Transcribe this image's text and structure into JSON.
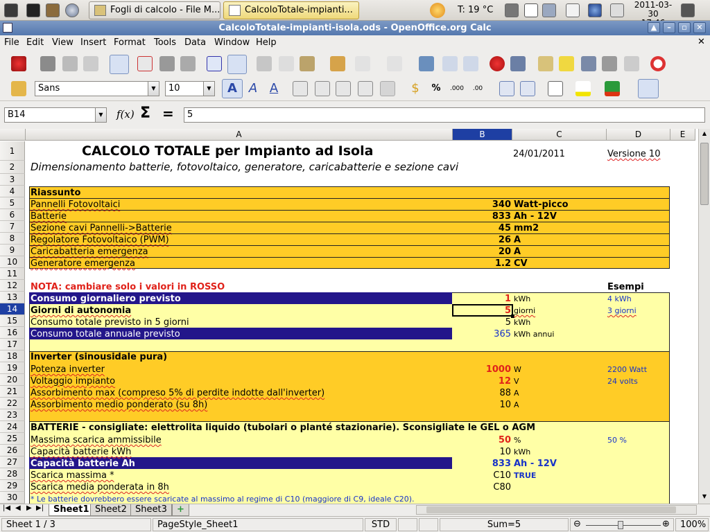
{
  "taskbar": {
    "tasks": [
      {
        "label": "Fogli di calcolo - File M..."
      },
      {
        "label": "CalcoloTotale-impianti..."
      }
    ],
    "weather": "T: 19 °C",
    "date": "2011-03-30",
    "time": "17:46"
  },
  "window": {
    "title": "CalcoloTotale-impianti-isola.ods - OpenOffice.org Calc"
  },
  "menu": [
    "File",
    "Edit",
    "View",
    "Insert",
    "Format",
    "Tools",
    "Data",
    "Window",
    "Help"
  ],
  "format_toolbar": {
    "font_name": "Sans",
    "font_size": "10"
  },
  "formula_bar": {
    "name_box": "B14",
    "content": "5"
  },
  "columns": [
    "A",
    "B",
    "C",
    "D",
    "E"
  ],
  "rows": [
    "1",
    "2",
    "3",
    "4",
    "5",
    "6",
    "7",
    "8",
    "9",
    "10",
    "11",
    "12",
    "13",
    "14",
    "15",
    "16",
    "17",
    "18",
    "19",
    "20",
    "21",
    "22",
    "23",
    "24",
    "25",
    "26",
    "27",
    "28",
    "29",
    "30"
  ],
  "sheet": {
    "title": "CALCOLO TOTALE per Impianto ad Isola",
    "date": "24/01/2011",
    "version": "Versione 10",
    "subtitle": "Dimensionamento batterie, fotovoltaico, generatore, caricabatterie e sezione cavi",
    "summary": {
      "heading": "Riassunto",
      "items": [
        {
          "label": "Pannelli Fotovoltaici",
          "value": "340",
          "unit": "Watt-picco"
        },
        {
          "label": "Batterie",
          "value": "833",
          "unit": "Ah - 12V"
        },
        {
          "label": "Sezione cavi Pannelli->Batterie",
          "value": "45",
          "unit": "mm2"
        },
        {
          "label": "Regolatore Fotovoltaico (PWM)",
          "value": "26",
          "unit": "A"
        },
        {
          "label": "Caricabatteria emergenza",
          "value": "20",
          "unit": "A"
        },
        {
          "label": "Generatore emergenza",
          "value": "1.2",
          "unit": "CV"
        }
      ]
    },
    "note": "NOTA: cambiare solo i valori in ROSSO",
    "examples_heading": "Esempi",
    "consumption": [
      {
        "label": "Consumo giornaliero previsto",
        "value": "1",
        "unit": "kWh",
        "example": "4 kWh"
      },
      {
        "label": "Giorni di autonomia",
        "value": "5",
        "unit": "giorni",
        "example": "3 giorni"
      },
      {
        "label": "Consumo totale previsto in 5 giorni",
        "value": "5",
        "unit": "kWh",
        "example": ""
      },
      {
        "label": "Consumo totale annuale previsto",
        "value": "365",
        "unit": "kWh annui",
        "example": ""
      }
    ],
    "inverter": {
      "heading": "Inverter (sinousidale pura)",
      "items": [
        {
          "label": "Potenza inverter",
          "value": "1000",
          "unit": "W",
          "example": "2200 Watt"
        },
        {
          "label": "Voltaggio impianto",
          "value": "12",
          "unit": "V",
          "example": "24 volts"
        },
        {
          "label": "Assorbimento max (compreso 5% di perdite indotte dall'inverter)",
          "value": "88",
          "unit": "A",
          "example": ""
        },
        {
          "label": "Assorbimento medio ponderato (su 8h)",
          "value": "10",
          "unit": "A",
          "example": ""
        }
      ]
    },
    "batteries": {
      "heading": "BATTERIE - consigliate: elettrolita liquido (tubolari o planté stazionarie). Sconsigliate le GEL o AGM",
      "items": [
        {
          "label": "Massima scarica ammissibile",
          "value": "50",
          "unit": "%",
          "example": "50 %"
        },
        {
          "label": "Capacità batterie kWh",
          "value": "10",
          "unit": "kWh",
          "example": ""
        },
        {
          "label": "Capacità batterie Ah",
          "value": "833",
          "unit": "Ah - 12V",
          "example": ""
        },
        {
          "label": "Scarica massima  *",
          "value": "C10",
          "unit": "TRUE",
          "example": ""
        },
        {
          "label": "Scarica media ponderata in 8h",
          "value": "C80",
          "unit": "",
          "example": ""
        }
      ],
      "footnote": "* Le batterie dovrebbero essere scaricate al massimo al regime di C10 (maggiore di C9, ideale C20)."
    }
  },
  "tabs": [
    "Sheet1",
    "Sheet2",
    "Sheet3"
  ],
  "status": {
    "sheet": "Sheet 1 / 3",
    "page_style": "PageStyle_Sheet1",
    "mode": "STD",
    "sum": "Sum=5",
    "zoom": "100%"
  }
}
